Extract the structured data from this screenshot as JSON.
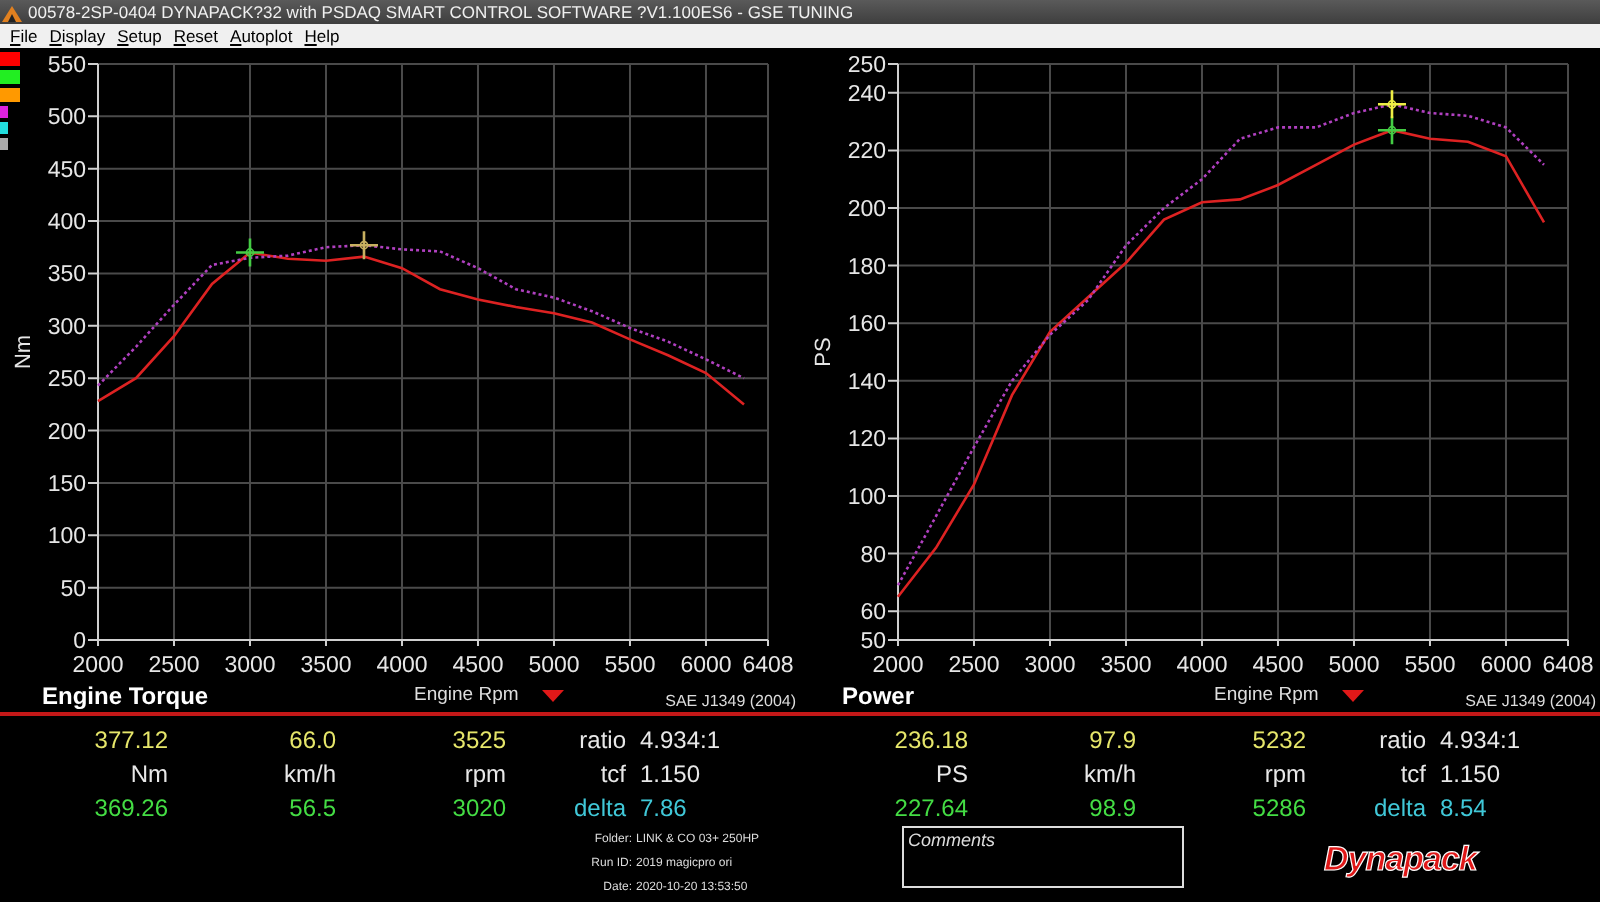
{
  "window": {
    "title": "00578-2SP-0404 DYNAPACK?32 with PSDAQ SMART CONTROL SOFTWARE ?V1.100ES6 - GSE TUNING"
  },
  "menu": [
    "File",
    "Display",
    "Setup",
    "Reset",
    "Autoplot",
    "Help"
  ],
  "legend_swatches": [
    {
      "color": "#ff0000",
      "kind": "block"
    },
    {
      "color": "#22ee22",
      "kind": "block"
    },
    {
      "color": "#ff9900",
      "kind": "block"
    },
    {
      "color": "#dd22dd",
      "kind": "bar"
    },
    {
      "color": "#22dddd",
      "kind": "bar"
    },
    {
      "color": "#aaaaaa",
      "kind": "bar"
    }
  ],
  "charts": [
    {
      "chart_data": {
        "type": "line",
        "ylabel": "Nm",
        "x": [
          2000,
          2250,
          2500,
          2750,
          3000,
          3250,
          3500,
          3750,
          4000,
          4250,
          4500,
          4750,
          5000,
          5250,
          5500,
          5750,
          6000,
          6250
        ],
        "xlim": [
          2000,
          6408
        ],
        "ylim": [
          0,
          550
        ],
        "xticks": [
          2000,
          2500,
          3000,
          3500,
          4000,
          4500,
          5000,
          5500,
          6000,
          6408
        ],
        "yticks": [
          0,
          50,
          100,
          150,
          200,
          250,
          300,
          350,
          400,
          450,
          500,
          550
        ],
        "series": [
          {
            "color": "#dd2222",
            "line_style": "solid",
            "values": [
              228,
              250,
              290,
              340,
              370,
              364,
              362,
              366,
              355,
              335,
              325,
              318,
              312,
              303,
              287,
              272,
              255,
              225
            ]
          },
          {
            "color": "#b040c0",
            "line_style": "dotted",
            "values": [
              243,
              280,
              320,
              358,
              365,
              367,
              375,
              377,
              373,
              371,
              355,
              335,
              327,
              314,
              298,
              285,
              268,
              250
            ]
          }
        ],
        "grid": true
      },
      "cursors": [
        {
          "color": "#44cc44"
        },
        {
          "color": "#c8b060"
        }
      ]
    },
    {
      "chart_data": {
        "type": "line",
        "ylabel": "PS",
        "x": [
          2000,
          2250,
          2500,
          2750,
          3000,
          3250,
          3500,
          3750,
          4000,
          4250,
          4500,
          4750,
          5000,
          5250,
          5500,
          5750,
          6000,
          6250
        ],
        "xlim": [
          2000,
          6408
        ],
        "ylim": [
          50,
          250
        ],
        "xticks": [
          2000,
          2500,
          3000,
          3500,
          4000,
          4500,
          5000,
          5500,
          6000,
          6408
        ],
        "yticks": [
          50,
          60,
          80,
          100,
          120,
          140,
          160,
          180,
          200,
          220,
          240,
          250
        ],
        "series": [
          {
            "color": "#dd2222",
            "line_style": "solid",
            "values": [
              65,
              82,
              104,
              135,
              157,
              169,
              181,
              196,
              202,
              203,
              208,
              215,
              222,
              227,
              224,
              223,
              218,
              195
            ]
          },
          {
            "color": "#b040c0",
            "line_style": "dotted",
            "values": [
              69,
              93,
              117,
              140,
              156,
              168,
              187,
              200,
              210,
              224,
              228,
              228,
              233,
              236,
              233,
              232,
              228,
              215
            ]
          }
        ],
        "grid": true
      },
      "cursors": [
        {
          "color": "#44cc44"
        },
        {
          "color": "#eeee44"
        }
      ]
    }
  ],
  "readouts": [
    {
      "title": "Engine Torque",
      "axis_label": "Engine Rpm",
      "standard": "SAE J1349 (2004)",
      "rows": [
        {
          "color": "#e6e66a",
          "cells": [
            "377.12",
            "66.0",
            "3525"
          ]
        },
        {
          "color": "#e8e8e8",
          "cells": [
            "Nm",
            "km/h",
            "rpm"
          ]
        },
        {
          "color": "#44dd44",
          "cells": [
            "369.26",
            "56.5",
            "3020"
          ]
        }
      ],
      "params": [
        {
          "label": "ratio",
          "value": "4.934:1",
          "color": "#e8e8e8"
        },
        {
          "label": "tcf",
          "value": "1.150",
          "color": "#e8e8e8"
        },
        {
          "label": "delta",
          "value": "7.86",
          "color": "#40c8d8"
        }
      ],
      "run_info": [
        {
          "label": "Folder:",
          "value": "LINK & CO 03+ 250HP"
        },
        {
          "label": "Run ID:",
          "value": "2019 magicpro ori"
        },
        {
          "label": "Date:",
          "value": "2020-10-20 13:53:50"
        }
      ]
    },
    {
      "title": "Power",
      "axis_label": "Engine Rpm",
      "standard": "SAE J1349 (2004)",
      "rows": [
        {
          "color": "#e6e66a",
          "cells": [
            "236.18",
            "97.9",
            "5232"
          ]
        },
        {
          "color": "#e8e8e8",
          "cells": [
            "PS",
            "km/h",
            "rpm"
          ]
        },
        {
          "color": "#44dd44",
          "cells": [
            "227.64",
            "98.9",
            "5286"
          ]
        }
      ],
      "params": [
        {
          "label": "ratio",
          "value": "4.934:1",
          "color": "#e8e8e8"
        },
        {
          "label": "tcf",
          "value": "1.150",
          "color": "#e8e8e8"
        },
        {
          "label": "delta",
          "value": "8.54",
          "color": "#40c8d8"
        }
      ],
      "comments": {
        "label": "Comments"
      },
      "logo": {
        "text": "Dynapack"
      }
    }
  ]
}
